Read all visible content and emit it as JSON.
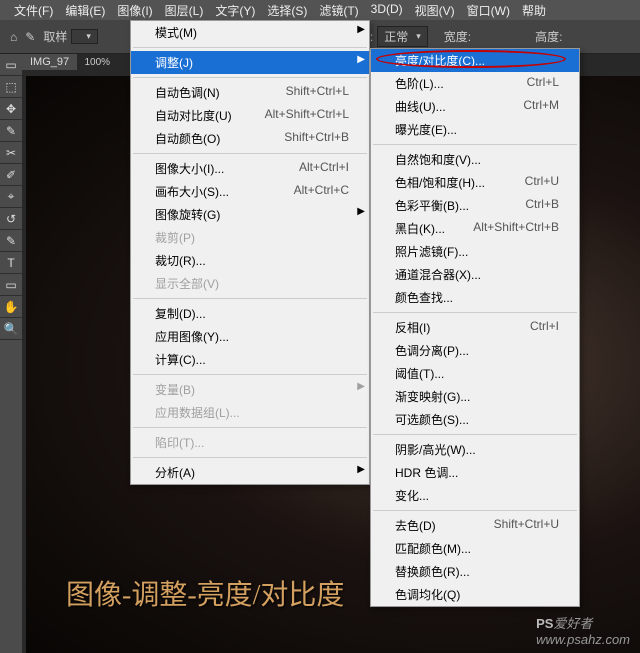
{
  "menubar": {
    "items": [
      "文件(F)",
      "编辑(E)",
      "图像(I)",
      "图层(L)",
      "文字(Y)",
      "选择(S)",
      "滤镜(T)",
      "3D(D)",
      "视图(V)",
      "窗口(W)",
      "帮助"
    ]
  },
  "optionbar": {
    "sample_label": "取样",
    "mode_label": "式:",
    "mode_value": "正常",
    "width_label": "宽度:",
    "height_label": "高度:"
  },
  "document": {
    "tab_name": "IMG_97",
    "zoom": "100%"
  },
  "tools": [
    "▭",
    "⬚",
    "✥",
    "✎",
    "✂",
    "✐",
    "⌖",
    "↺",
    "✎",
    "T",
    "▭",
    "✋",
    "🔍"
  ],
  "menu1": {
    "rows": [
      {
        "label": "模式(M)",
        "sub": true
      },
      {
        "sep": true
      },
      {
        "label": "调整(J)",
        "sub": true,
        "hl": true
      },
      {
        "sep": true
      },
      {
        "label": "自动色调(N)",
        "sc": "Shift+Ctrl+L"
      },
      {
        "label": "自动对比度(U)",
        "sc": "Alt+Shift+Ctrl+L"
      },
      {
        "label": "自动颜色(O)",
        "sc": "Shift+Ctrl+B"
      },
      {
        "sep": true
      },
      {
        "label": "图像大小(I)...",
        "sc": "Alt+Ctrl+I"
      },
      {
        "label": "画布大小(S)...",
        "sc": "Alt+Ctrl+C"
      },
      {
        "label": "图像旋转(G)",
        "sub": true
      },
      {
        "label": "裁剪(P)",
        "dis": true
      },
      {
        "label": "裁切(R)..."
      },
      {
        "label": "显示全部(V)",
        "dis": true
      },
      {
        "sep": true
      },
      {
        "label": "复制(D)..."
      },
      {
        "label": "应用图像(Y)..."
      },
      {
        "label": "计算(C)..."
      },
      {
        "sep": true
      },
      {
        "label": "变量(B)",
        "sub": true,
        "dis": true
      },
      {
        "label": "应用数据组(L)...",
        "dis": true
      },
      {
        "sep": true
      },
      {
        "label": "陷印(T)...",
        "dis": true
      },
      {
        "sep": true
      },
      {
        "label": "分析(A)",
        "sub": true
      }
    ]
  },
  "menu2": {
    "rows": [
      {
        "label": "亮度/对比度(C)...",
        "hl": true
      },
      {
        "label": "色阶(L)...",
        "sc": "Ctrl+L"
      },
      {
        "label": "曲线(U)...",
        "sc": "Ctrl+M"
      },
      {
        "label": "曝光度(E)..."
      },
      {
        "sep": true
      },
      {
        "label": "自然饱和度(V)..."
      },
      {
        "label": "色相/饱和度(H)...",
        "sc": "Ctrl+U"
      },
      {
        "label": "色彩平衡(B)...",
        "sc": "Ctrl+B"
      },
      {
        "label": "黑白(K)...",
        "sc": "Alt+Shift+Ctrl+B"
      },
      {
        "label": "照片滤镜(F)..."
      },
      {
        "label": "通道混合器(X)..."
      },
      {
        "label": "颜色查找..."
      },
      {
        "sep": true
      },
      {
        "label": "反相(I)",
        "sc": "Ctrl+I"
      },
      {
        "label": "色调分离(P)..."
      },
      {
        "label": "阈值(T)..."
      },
      {
        "label": "渐变映射(G)..."
      },
      {
        "label": "可选颜色(S)..."
      },
      {
        "sep": true
      },
      {
        "label": "阴影/高光(W)..."
      },
      {
        "label": "HDR 色调..."
      },
      {
        "label": "变化..."
      },
      {
        "sep": true
      },
      {
        "label": "去色(D)",
        "sc": "Shift+Ctrl+U"
      },
      {
        "label": "匹配颜色(M)..."
      },
      {
        "label": "替换颜色(R)..."
      },
      {
        "label": "色调均化(Q)"
      }
    ]
  },
  "bottom_caption": "图像-调整-亮度/对比度",
  "watermark": {
    "brand": "PS",
    "suffix": "爱好者",
    "url": "www.psahz.com"
  }
}
